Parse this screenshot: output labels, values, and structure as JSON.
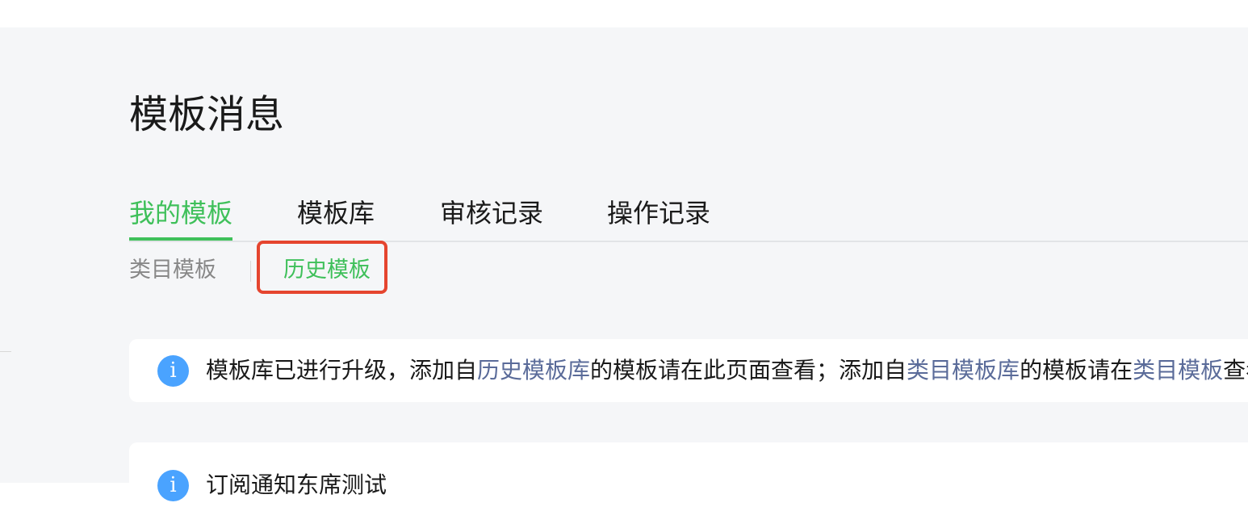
{
  "page": {
    "title": "模板消息"
  },
  "tabs": [
    {
      "label": "我的模板",
      "active": true
    },
    {
      "label": "模板库",
      "active": false
    },
    {
      "label": "审核记录",
      "active": false
    },
    {
      "label": "操作记录",
      "active": false
    }
  ],
  "subtabs": [
    {
      "label": "类目模板",
      "active": false
    },
    {
      "label": "历史模板",
      "active": true
    }
  ],
  "notice": {
    "icon": "info-icon",
    "text_1": "模板库已进行升级，添加自",
    "link_1": "历史模板库",
    "text_2": "的模板请在此页面查看；添加自",
    "link_2": "类目模板库",
    "text_3": "的模板请在",
    "link_3": "类目模板",
    "text_4": "查看"
  },
  "template_card": {
    "icon": "info-icon",
    "title": "订阅通知东席测试"
  },
  "colors": {
    "accent": "#3fc05a",
    "highlight": "#e5452f",
    "link": "#5a6b99",
    "info": "#4aa3ff"
  }
}
